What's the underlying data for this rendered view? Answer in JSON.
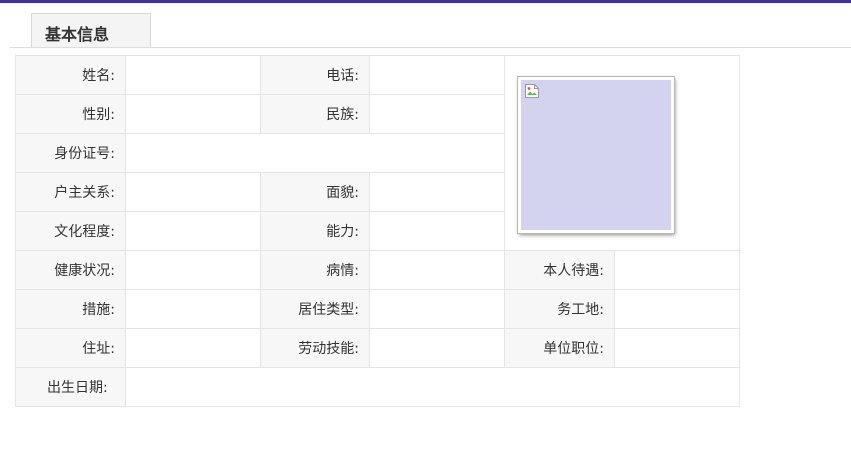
{
  "tab": {
    "label": "基本信息"
  },
  "form": {
    "name_label": "姓名:",
    "phone_label": "电话:",
    "gender_label": "性别:",
    "ethnicity_label": "民族:",
    "id_number_label": "身份证号:",
    "household_relation_label": "户主关系:",
    "political_status_label": "面貌:",
    "education_label": "文化程度:",
    "ability_label": "能力:",
    "health_label": "健康状况:",
    "illness_label": "病情:",
    "benefits_label": "本人待遇:",
    "measures_label": "措施:",
    "residence_type_label": "居住类型:",
    "work_location_label": "务工地:",
    "work_unit_position_label": "单位职位:",
    "address_label": "住址:",
    "labor_skills_label": "劳动技能:",
    "birth_date_label": "出生日期:"
  },
  "colors": {
    "top_bar": "#3f2f9d",
    "label_background": "#f7f7f7",
    "cell_border": "#e5e5e5",
    "photo_placeholder": "#d3d3ef"
  },
  "photo": {
    "icon": "broken-image-icon"
  }
}
